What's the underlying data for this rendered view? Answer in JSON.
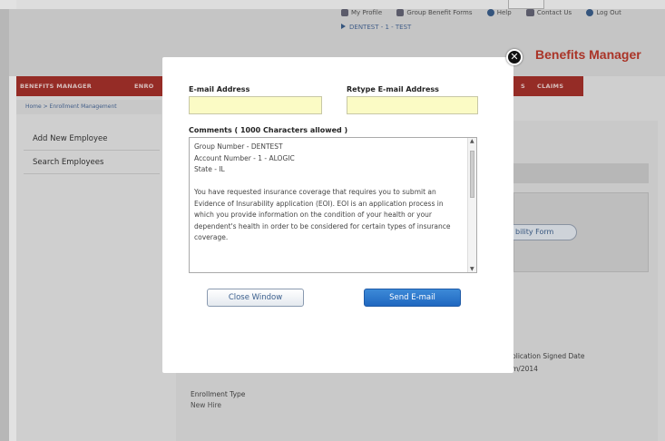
{
  "header": {
    "links": [
      {
        "label": "My Profile",
        "icon": "profile-icon"
      },
      {
        "label": "Group Benefit Forms",
        "icon": "forms-icon"
      },
      {
        "label": "Help",
        "icon": "help-icon"
      },
      {
        "label": "Contact Us",
        "icon": "chat-icon"
      },
      {
        "label": "Log Out",
        "icon": "logout-icon"
      }
    ],
    "group": "DENTEST - 1 - TEST",
    "brand": "Benefits Manager"
  },
  "nav": {
    "items": [
      "BENEFITS MANAGER",
      "ENRO",
      "S",
      "CLAIMS"
    ]
  },
  "breadcrumb": "Home > Enrollment Management",
  "sidebar": {
    "items": [
      "Add New Employee",
      "Search Employees"
    ]
  },
  "background": {
    "panel_button": "bility Form",
    "app_date_label": "plication Signed Date",
    "app_date_value": "m/2014",
    "enrollment_type_label": "Enrollment Type",
    "enrollment_type_value": "New Hire"
  },
  "modal": {
    "email_label": "E-mail Address",
    "retype_label": "Retype E-mail Address",
    "email_value": "",
    "retype_value": "",
    "comments_label": "Comments  ( 1000 Characters allowed )",
    "comments_text": "Group Number - DENTEST\nAccount Number - 1 - ALOGIC\nState - IL\n\nYou have requested insurance coverage that requires you to submit an Evidence of Insurability application (EOI). EOI is an application process in which you provide information on the condition of your health or your dependent's health in order to be considered for certain types of insurance coverage.",
    "close_button": "Close Window",
    "send_button": "Send E-mail",
    "close_x": "✕"
  },
  "colors": {
    "brand_red": "#c0392b",
    "nav_red": "#a8302a",
    "field_yellow": "#fbfbc5",
    "send_blue": "#1f67c0"
  }
}
